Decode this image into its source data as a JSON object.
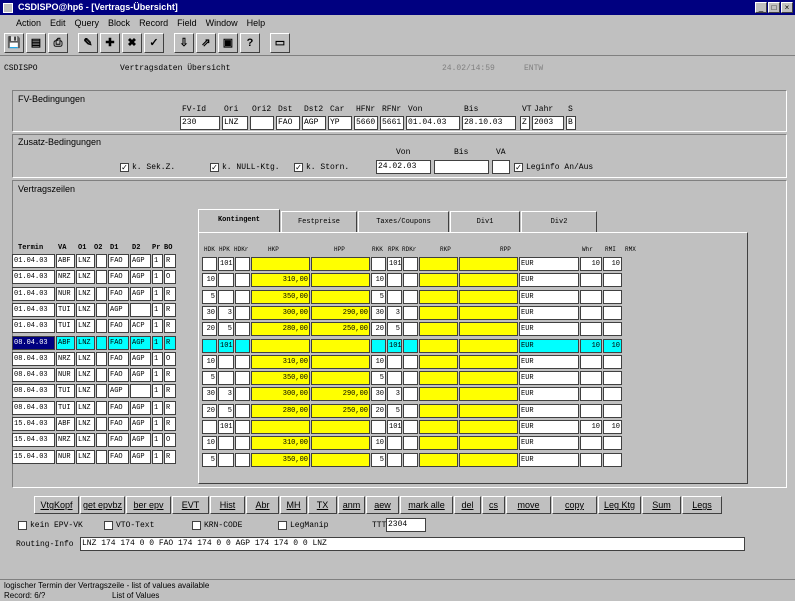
{
  "window": {
    "title": "CSDISPO@hp6 - [Vertrags-Übersicht]"
  },
  "menu": [
    "Action",
    "Edit",
    "Query",
    "Block",
    "Record",
    "Field",
    "Window",
    "Help"
  ],
  "toolbar": [
    "💾",
    "▤",
    "⎙",
    "✎",
    "✚",
    "✖",
    "✓",
    "⇩",
    "⇗",
    "▣",
    "?",
    "▭"
  ],
  "form": {
    "app": "CSDISPO",
    "title": "Vertragsdaten Übersicht",
    "datetime": "24.02/14:59",
    "user": "ENTW"
  },
  "fv": {
    "title": "FV-Bedingungen",
    "labels": [
      "FV-Id",
      "Ori",
      "Ori2",
      "Dst",
      "Dst2",
      "Car",
      "HFNr",
      "RFNr",
      "Von",
      "Bis",
      "VT",
      "Jahr",
      "S"
    ],
    "values": [
      "230",
      "LNZ",
      "",
      "FAO",
      "AGP",
      "YP",
      "5660",
      "5661",
      "01.04.03",
      "28.10.03",
      "Z",
      "2003",
      "B"
    ]
  },
  "zusatz": {
    "title": "Zusatz-Bedingungen",
    "chk1": "k. Sek.Z.",
    "chk2": "k. NULL-Ktg.",
    "chk3": "k. Storn.",
    "von_label": "Von",
    "bis_label": "Bis",
    "va_label": "VA",
    "von": "24.02.03",
    "bis": "",
    "va": "",
    "leginfo": "Leginfo An/Aus"
  },
  "vz": {
    "title": "Vertragszeilen",
    "headers": [
      "Termin",
      "VA",
      "O1",
      "O2",
      "D1",
      "D2",
      "Pr",
      "BO"
    ],
    "rows": [
      [
        "01.04.03",
        "ABF",
        "LNZ",
        "",
        "FAO",
        "AGP",
        "1",
        "R"
      ],
      [
        "01.04.03",
        "NRZ",
        "LNZ",
        "",
        "FAO",
        "AGP",
        "1",
        "O"
      ],
      [
        "01.04.03",
        "NUR",
        "LNZ",
        "",
        "FAO",
        "AGP",
        "1",
        "R"
      ],
      [
        "01.04.03",
        "TUI",
        "LNZ",
        "",
        "AGP",
        "",
        "1",
        "R"
      ],
      [
        "01.04.03",
        "TUI",
        "LNZ",
        "",
        "FAO",
        "ACP",
        "1",
        "R"
      ],
      [
        "08.04.03",
        "ABF",
        "LNZ",
        "",
        "FAO",
        "AGP",
        "1",
        "R"
      ],
      [
        "08.04.03",
        "NRZ",
        "LNZ",
        "",
        "FAO",
        "AGP",
        "1",
        "O"
      ],
      [
        "08.04.03",
        "NUR",
        "LNZ",
        "",
        "FAO",
        "AGP",
        "1",
        "R"
      ],
      [
        "08.04.03",
        "TUI",
        "LNZ",
        "",
        "AGP",
        "",
        "1",
        "R"
      ],
      [
        "08.04.03",
        "TUI",
        "LNZ",
        "",
        "FAO",
        "AGP",
        "1",
        "R"
      ],
      [
        "15.04.03",
        "ABF",
        "LNZ",
        "",
        "FAO",
        "AGP",
        "1",
        "R"
      ],
      [
        "15.04.03",
        "NRZ",
        "LNZ",
        "",
        "FAO",
        "AGP",
        "1",
        "O"
      ],
      [
        "15.04.03",
        "NUR",
        "LNZ",
        "",
        "FAO",
        "AGP",
        "1",
        "R"
      ]
    ]
  },
  "tabs": [
    "Kontingent",
    "Festpreise",
    "Taxes/Coupons",
    "Div1",
    "Div2"
  ],
  "grid": {
    "headers": [
      "HDK",
      "HPK",
      "HDKr",
      "HKP",
      "HPP",
      "RKK",
      "RPK",
      "RDKr",
      "RKP",
      "RPP",
      "Whr",
      "RMI",
      "RMX"
    ],
    "rows": [
      [
        "",
        "101",
        "",
        "",
        "",
        "",
        "101",
        "",
        "",
        "",
        "EUR",
        "10",
        "10"
      ],
      [
        "10",
        "",
        "",
        "310,00",
        "",
        "10",
        "",
        "",
        "",
        "",
        "EUR",
        "",
        ""
      ],
      [
        "5",
        "",
        "",
        "350,00",
        "",
        "5",
        "",
        "",
        "",
        "",
        "EUR",
        "",
        ""
      ],
      [
        "30",
        "3",
        "",
        "300,00",
        "290,00",
        "30",
        "3",
        "",
        "",
        "",
        "EUR",
        "",
        ""
      ],
      [
        "20",
        "5",
        "",
        "280,00",
        "250,00",
        "20",
        "5",
        "",
        "",
        "",
        "EUR",
        "",
        ""
      ],
      [
        "",
        "101",
        "",
        "",
        "",
        "",
        "101",
        "",
        "",
        "",
        "EUR",
        "10",
        "10"
      ],
      [
        "10",
        "",
        "",
        "310,00",
        "",
        "10",
        "",
        "",
        "",
        "",
        "EUR",
        "",
        ""
      ],
      [
        "5",
        "",
        "",
        "350,00",
        "",
        "5",
        "",
        "",
        "",
        "",
        "EUR",
        "",
        ""
      ],
      [
        "30",
        "3",
        "",
        "300,00",
        "290,00",
        "30",
        "3",
        "",
        "",
        "",
        "EUR",
        "",
        ""
      ],
      [
        "20",
        "5",
        "",
        "280,00",
        "250,00",
        "20",
        "5",
        "",
        "",
        "",
        "EUR",
        "",
        ""
      ],
      [
        "",
        "101",
        "",
        "",
        "",
        "",
        "101",
        "",
        "",
        "",
        "EUR",
        "10",
        "10"
      ],
      [
        "10",
        "",
        "",
        "310,00",
        "",
        "10",
        "",
        "",
        "",
        "",
        "EUR",
        "",
        ""
      ],
      [
        "5",
        "",
        "",
        "350,00",
        "",
        "5",
        "",
        "",
        "",
        "",
        "EUR",
        "",
        ""
      ]
    ]
  },
  "buttons": [
    "VtgKopf",
    "get epvbz",
    "ber epv",
    "EVT",
    "Hist",
    "Abr",
    "MH",
    "TX",
    "anm",
    "aew",
    "mark alle",
    "del",
    "cs",
    "move",
    "copy",
    "Leg Ktg",
    "Sum",
    "Legs"
  ],
  "bottom": {
    "chk1": "kein EPV-VK",
    "chk2": "VTO-Text",
    "chk3": "KRN-CODE",
    "chk4": "LegManip",
    "ttt_label": "TTT",
    "ttt": "2304",
    "routing_label": "Routing-Info",
    "routing": "LNZ 174 174   0   0 FAO  174 174   0   0 AGP  174 174   0   0 LNZ"
  },
  "status": {
    "line1": "logischer Termin der Vertragszeile - list of values available",
    "record": "Record: 6/?",
    "lov": "List of Values"
  },
  "colors": {
    "title": "#000080",
    "highlight": "#ffff00",
    "selected": "#00ffff"
  }
}
